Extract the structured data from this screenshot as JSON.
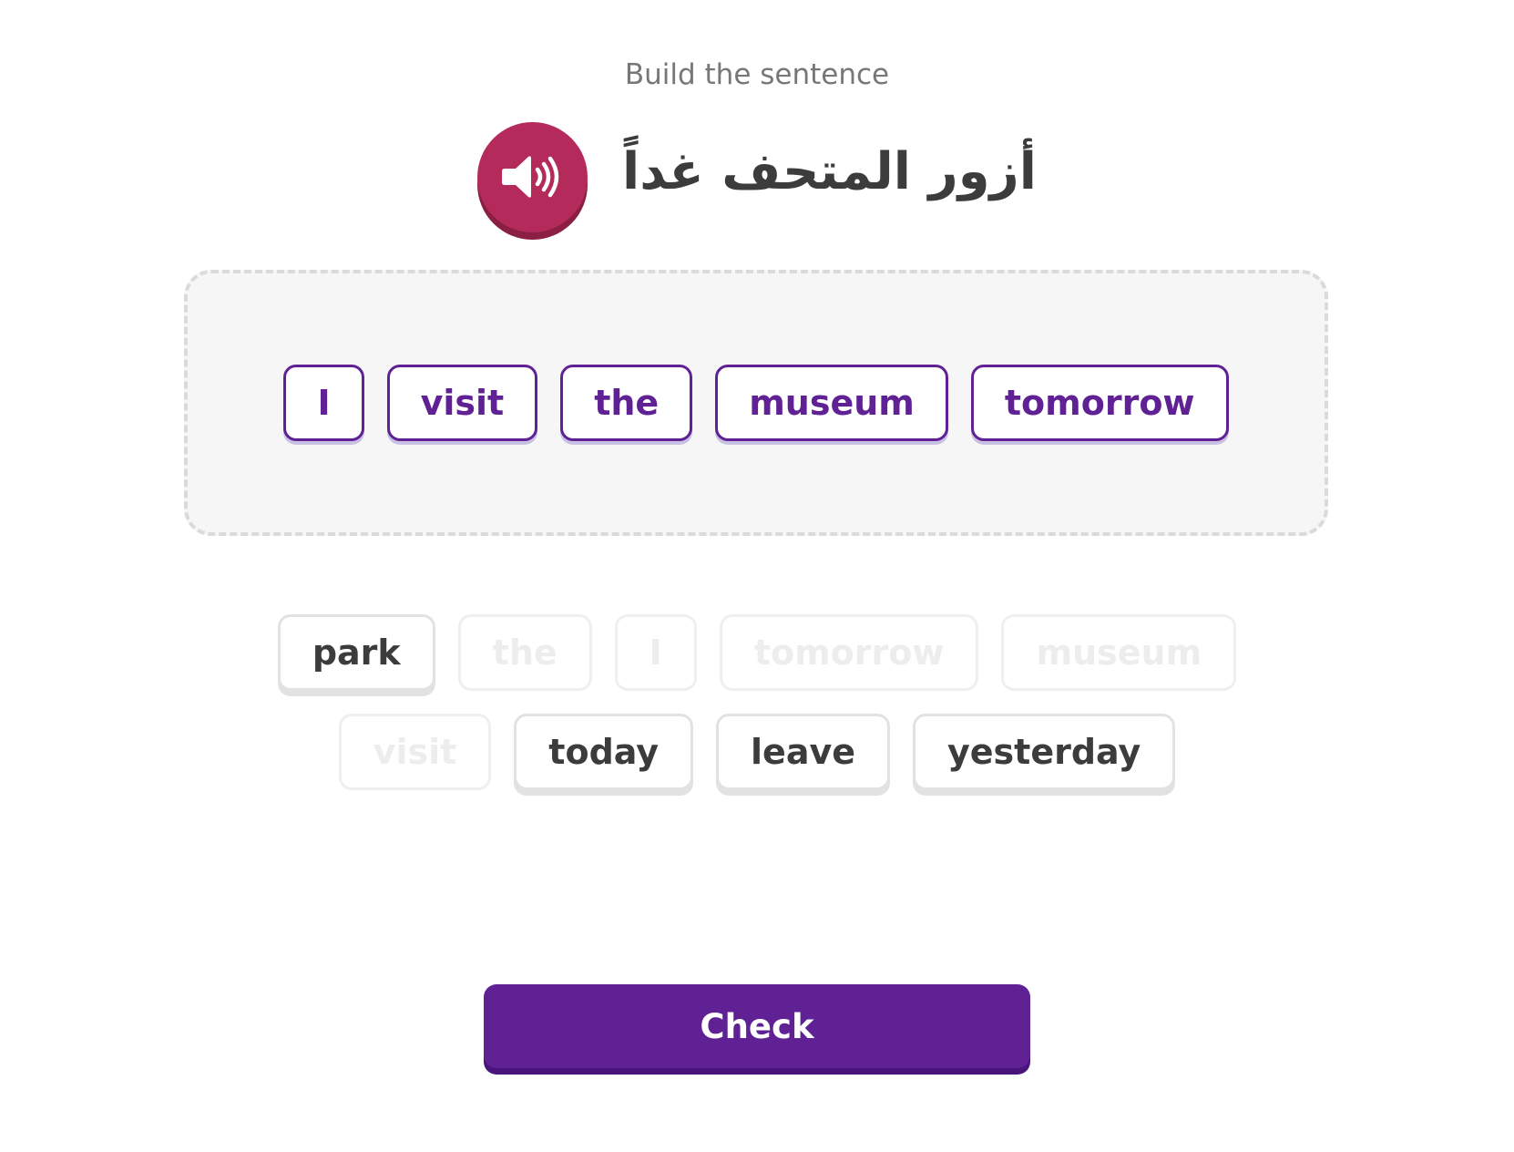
{
  "exercise": {
    "instruction": "Build the sentence",
    "prompt": "أزور المتحف غداً",
    "audio_icon": "speaker-icon"
  },
  "answer": {
    "tiles": [
      {
        "label": "I"
      },
      {
        "label": "visit"
      },
      {
        "label": "the"
      },
      {
        "label": "museum"
      },
      {
        "label": "tomorrow"
      }
    ]
  },
  "bank": {
    "rows": [
      [
        {
          "label": "park",
          "state": "available"
        },
        {
          "label": "the",
          "state": "used"
        },
        {
          "label": "I",
          "state": "used"
        },
        {
          "label": "tomorrow",
          "state": "used"
        },
        {
          "label": "museum",
          "state": "used"
        }
      ],
      [
        {
          "label": "visit",
          "state": "used"
        },
        {
          "label": "today",
          "state": "available"
        },
        {
          "label": "leave",
          "state": "available"
        },
        {
          "label": "yesterday",
          "state": "available"
        }
      ]
    ]
  },
  "actions": {
    "check_label": "Check"
  },
  "colors": {
    "accent": "#5f2194",
    "audio": "#b42b5b"
  }
}
